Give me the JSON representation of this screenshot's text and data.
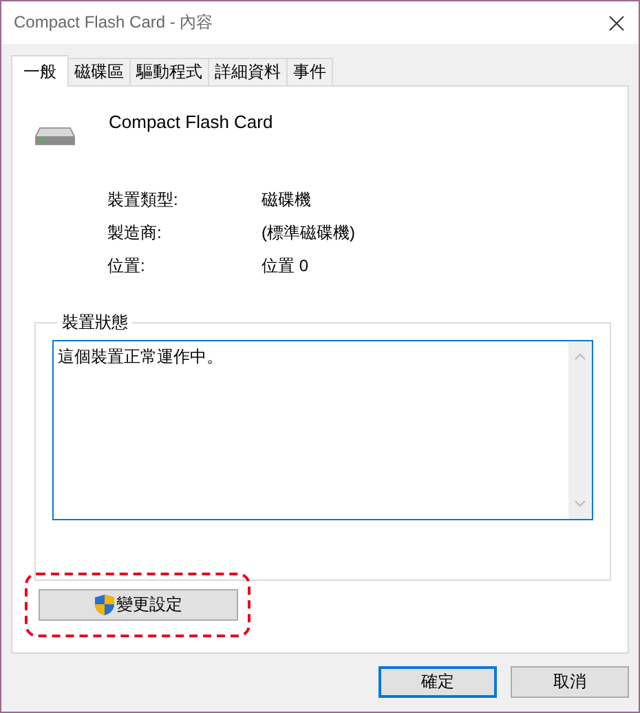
{
  "window": {
    "title": "Compact Flash Card - 內容"
  },
  "tabs": [
    {
      "label": "一般",
      "selected": true
    },
    {
      "label": "磁碟區",
      "selected": false
    },
    {
      "label": "驅動程式",
      "selected": false
    },
    {
      "label": "詳細資料",
      "selected": false
    },
    {
      "label": "事件",
      "selected": false
    }
  ],
  "device": {
    "name": "Compact Flash Card"
  },
  "properties": [
    {
      "label": "裝置類型:",
      "value": "磁碟機"
    },
    {
      "label": "製造商:",
      "value": "(標準磁碟機)"
    },
    {
      "label": "位置:",
      "value": "位置 0"
    }
  ],
  "status": {
    "title": "裝置狀態",
    "text": "這個裝置正常運作中。"
  },
  "change_settings_button": {
    "label": "變更設定",
    "highlighted": true
  },
  "buttons": [
    {
      "label": "確定",
      "default": true
    },
    {
      "label": "取消",
      "default": false
    }
  ]
}
